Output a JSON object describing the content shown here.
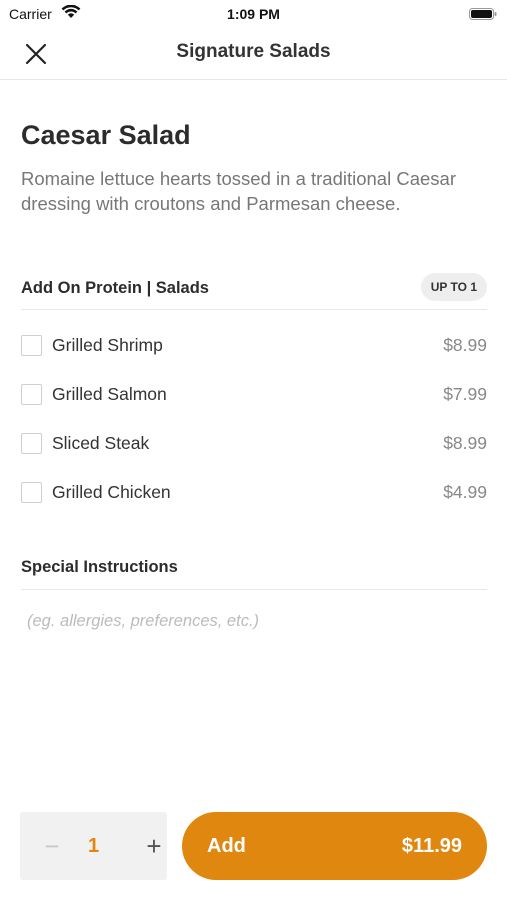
{
  "status_bar": {
    "carrier": "Carrier",
    "time": "1:09 PM"
  },
  "nav": {
    "title": "Signature Salads",
    "close_icon": "close-icon"
  },
  "item": {
    "name": "Caesar Salad",
    "description": "Romaine lettuce hearts tossed in a traditional Caesar dressing with croutons and Parmesan cheese."
  },
  "modifier_group": {
    "title": "Add On Protein | Salads",
    "limit": "UP TO 1",
    "options": [
      {
        "label": "Grilled Shrimp",
        "price": "$8.99",
        "checked": false
      },
      {
        "label": "Grilled Salmon",
        "price": "$7.99",
        "checked": false
      },
      {
        "label": "Sliced Steak",
        "price": "$8.99",
        "checked": false
      },
      {
        "label": "Grilled Chicken",
        "price": "$4.99",
        "checked": false
      }
    ]
  },
  "special_instructions": {
    "title": "Special Instructions",
    "placeholder": "(eg. allergies, preferences, etc.)",
    "value": ""
  },
  "footer": {
    "quantity": "1",
    "minus_icon": "−",
    "plus_icon": "+",
    "add_label": "Add",
    "add_price": "$11.99"
  },
  "colors": {
    "accent": "#e0870f",
    "stepper_bg": "#f1f1f1",
    "badge_bg": "#eeeeee"
  }
}
